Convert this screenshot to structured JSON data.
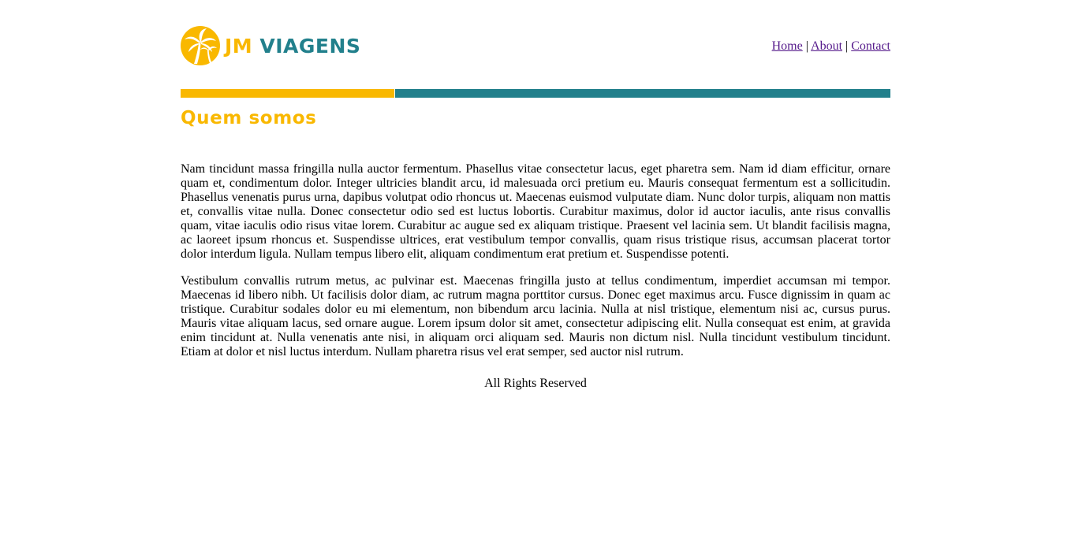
{
  "brand": {
    "name_part1": "JM",
    "name_part2": "VIAGENS",
    "color_primary": "#f9b800",
    "color_secondary": "#22808c",
    "logo_icon": "palm-tree-icon"
  },
  "nav": {
    "items": [
      {
        "label": "Home"
      },
      {
        "label": "About"
      },
      {
        "label": "Contact"
      }
    ],
    "separator": "|"
  },
  "main": {
    "title": "Quem somos",
    "paragraphs": [
      "Nam tincidunt massa fringilla nulla auctor fermentum. Phasellus vitae consectetur lacus, eget pharetra sem. Nam id diam efficitur, ornare quam et, condimentum dolor. Integer ultricies blandit arcu, id malesuada orci pretium eu. Mauris consequat fermentum est a sollicitudin. Phasellus venenatis purus urna, dapibus volutpat odio rhoncus ut. Maecenas euismod vulputate diam. Nunc dolor turpis, aliquam non mattis et, convallis vitae nulla. Donec consectetur odio sed est luctus lobortis. Curabitur maximus, dolor id auctor iaculis, ante risus convallis quam, vitae iaculis odio risus vitae lorem. Curabitur ac augue sed ex aliquam tristique. Praesent vel lacinia sem. Ut blandit facilisis magna, ac laoreet ipsum rhoncus et. Suspendisse ultrices, erat vestibulum tempor convallis, quam risus tristique risus, accumsan placerat tortor dolor interdum ligula. Nullam tempus libero elit, aliquam condimentum erat pretium et. Suspendisse potenti.",
      "Vestibulum convallis rutrum metus, ac pulvinar est. Maecenas fringilla justo at tellus condimentum, imperdiet accumsan mi tempor. Maecenas id libero nibh. Ut facilisis dolor diam, ac rutrum magna porttitor cursus. Donec eget maximus arcu. Fusce dignissim in quam ac tristique. Curabitur sodales dolor eu mi elementum, non bibendum arcu lacinia. Nulla at nisl tristique, elementum nisi ac, cursus purus. Mauris vitae aliquam lacus, sed ornare augue. Lorem ipsum dolor sit amet, consectetur adipiscing elit. Nulla consequat est enim, at gravida enim tincidunt at. Nulla venenatis ante nisi, in aliquam orci aliquam sed. Mauris non dictum nisl. Nulla tincidunt vestibulum tincidunt. Etiam at dolor et nisl luctus interdum. Nullam pharetra risus vel erat semper, sed auctor nisl rutrum."
    ]
  },
  "footer": {
    "text": "All Rights Reserved"
  },
  "link_color": "#551a8b"
}
